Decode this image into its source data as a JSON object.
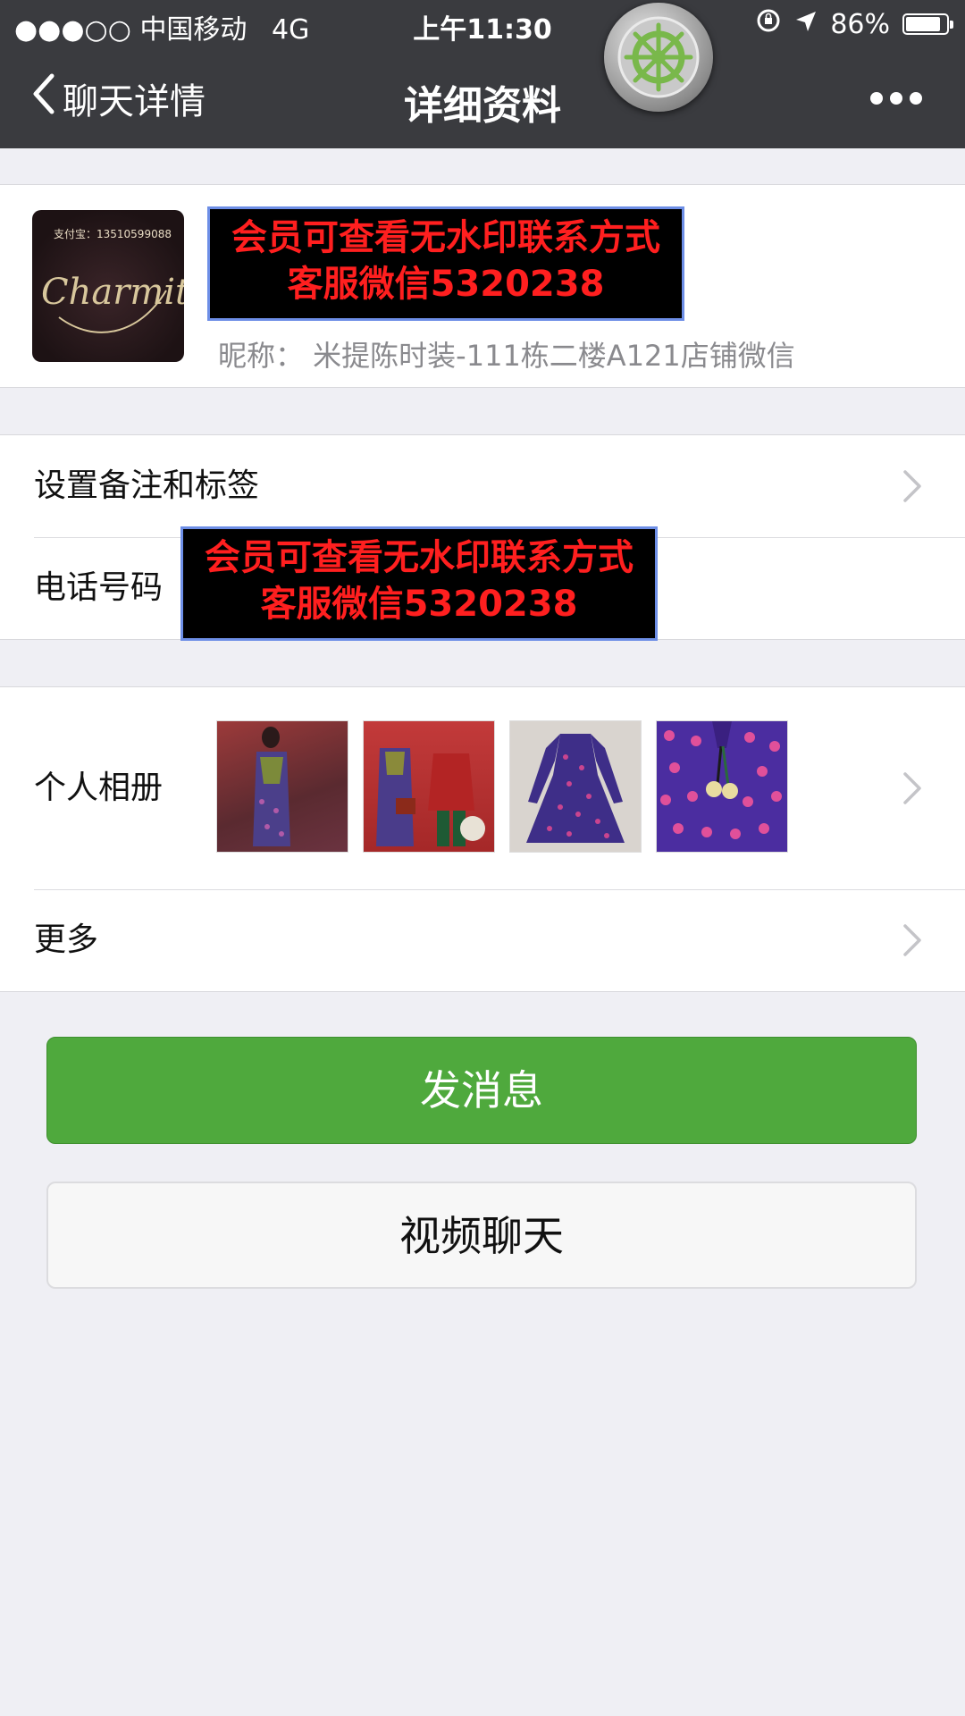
{
  "status_bar": {
    "signal": "●●●○○",
    "carrier": "中国移动",
    "network": "4G",
    "time": "上午11:30",
    "battery": "86%",
    "battery_level": 0.86
  },
  "nav": {
    "back_label": "聊天详情",
    "title": "详细资料"
  },
  "profile": {
    "avatar_caption": "支付宝：13510599088",
    "avatar_script": "Charmity",
    "watermark_line1": "会员可查看无水印联系方式",
    "watermark_line2": "客服微信5320238",
    "nickname": "昵称：  米提陈时装-111栋二楼A121店铺微信"
  },
  "settings": {
    "remark_label": "设置备注和标签",
    "phone_label": "电话号码",
    "phone_watermark_line1": "会员可查看无水印联系方式",
    "phone_watermark_line2": "客服微信5320238"
  },
  "album": {
    "label": "个人相册",
    "more_label": "更多"
  },
  "actions": {
    "send_message": "发消息",
    "video_call": "视频聊天"
  },
  "colors": {
    "nav_bg": "#3a3b3f",
    "primary_green": "#4fa93d",
    "page_bg": "#efeff4",
    "watermark_red": "#ff1f1f"
  }
}
